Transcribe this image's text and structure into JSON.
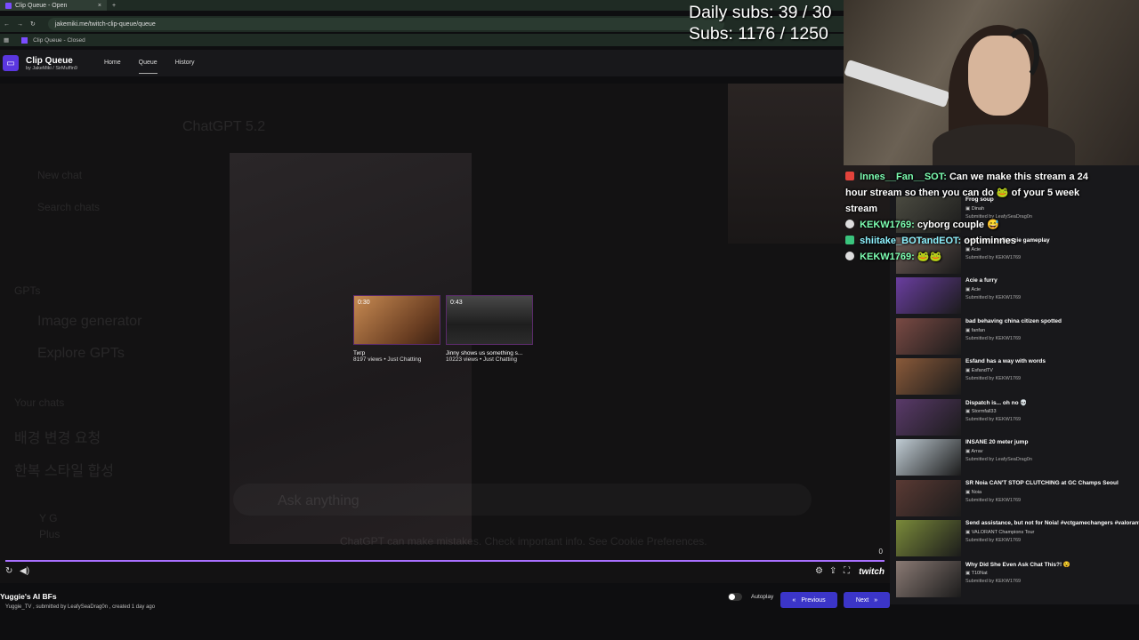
{
  "browser": {
    "tab_title": "Clip Queue - Open",
    "new_tab": "+",
    "url": "jakemiki.me/twitch-clip-queue/queue",
    "bookmark": "Clip Queue - Closed"
  },
  "app": {
    "title": "Clip Queue",
    "byline": "by JakeMiki / SirMuffin9",
    "nav": [
      "Home",
      "Queue",
      "History"
    ]
  },
  "overlay": {
    "daily_subs": "Daily subs: 39 / 30",
    "subs": "Subs: 1176 / 1250"
  },
  "background_ghost": {
    "model": "ChatGPT 5.2",
    "new_chat": "New chat",
    "search": "Search chats",
    "gpts": "GPTs",
    "image_gen": "Image generator",
    "explore": "Explore GPTs",
    "your_chats": "Your chats",
    "k1": "배경 변경 요청",
    "k2": "한복 스타일 합성",
    "user": "Y G",
    "plan": "Plus",
    "input": "Ask anything",
    "disclaimer": "ChatGPT can make mistakes. Check important info. See Cookie Preferences."
  },
  "suggestions": [
    {
      "duration": "0:30",
      "title": "Тигр",
      "meta": "8197 views • Just Chatting"
    },
    {
      "duration": "0:43",
      "title": "Jinny shows us something s...",
      "meta": "10223 views • Just Chatting"
    }
  ],
  "player": {
    "progress": 1.0,
    "counter": "0",
    "twitch": "twitch"
  },
  "clip": {
    "title": "Yuggie's AI BFs",
    "meta": "Yuggie_TV , submitted by LeafySeaDrag0n , created 1 day ago"
  },
  "controls": {
    "autoplay": "Autoplay",
    "previous": "Previous",
    "next": "Next"
  },
  "queue": [
    {
      "title": "Frog soup",
      "channel": "Dinah",
      "submitted": "Submitted by LeafySeaDrag0n",
      "color": "#4a4a40"
    },
    {
      "title": "Acie react to Bonnie gameplay",
      "channel": "Acie",
      "submitted": "Submitted by KEKW1769",
      "color": "#6b5a55"
    },
    {
      "title": "Acie a furry",
      "channel": "Acie",
      "submitted": "Submitted by KEKW1769",
      "color": "#6a3ea0"
    },
    {
      "title": "bad behaving china citizen spotted",
      "channel": "fanfan",
      "submitted": "Submitted by KEKW1769",
      "color": "#7a4a44"
    },
    {
      "title": "Esfand has a way with words",
      "channel": "EsfandTV",
      "submitted": "Submitted by KEKW1769",
      "color": "#8a5a3a"
    },
    {
      "title": "Dispatch is... oh no 💀",
      "channel": "Stormfall33",
      "submitted": "Submitted by KEKW1769",
      "color": "#5a3a6a"
    },
    {
      "title": "INSANE 20 meter jump",
      "channel": "Arrav",
      "submitted": "Submitted by LeafySeaDrag0n",
      "color": "#c0ccd4"
    },
    {
      "title": "SR Noia CAN'T STOP CLUTCHING at GC Champs Seoul",
      "channel": "Noia",
      "submitted": "Submitted by KEKW1769",
      "color": "#5a3a34"
    },
    {
      "title": "Send assistance, but not for Noia! #vctgamechangers #valorant #shorts #shorts",
      "channel": "VALORANT Champions Tour",
      "submitted": "Submitted by KEKW1769",
      "color": "#7a8a3a"
    },
    {
      "title": "Why Did She Even Ask Chat This?! 😵",
      "channel": "T10Nat",
      "submitted": "Submitted by KEKW1769",
      "color": "#8a7a74"
    }
  ],
  "chat": [
    {
      "user": "Innes__Fan__SOT:",
      "text": "Can we make this stream a 24 hour stream so then you can do 🐸 of your 5 week stream"
    },
    {
      "user": "KEKW1769:",
      "text": "cyborg couple 😅"
    },
    {
      "user": "shiitake_BOTandEOT:",
      "text": "optiminnes"
    },
    {
      "user": "KEKW1769:",
      "text": "🐸🐸"
    }
  ],
  "icons": {
    "replay": "replay-icon",
    "volume": "volume-icon",
    "settings": "gear-icon",
    "share": "share-icon",
    "fullscreen": "fullscreen-icon"
  },
  "colors": {
    "accent": "#a970ff",
    "button": "#3b35c8",
    "chat_name": "#7dffb2"
  }
}
